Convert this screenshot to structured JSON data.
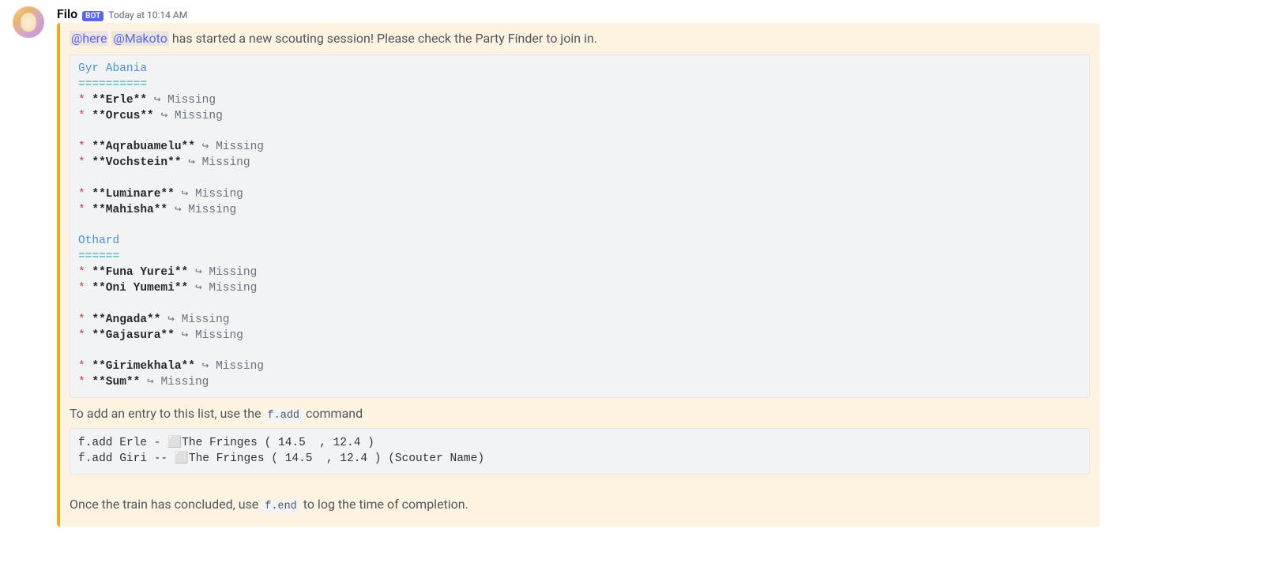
{
  "author": {
    "name": "Filo",
    "bot_label": "BOT",
    "timestamp": "Today at 10:14 AM"
  },
  "embed": {
    "mention_here": "@here",
    "mention_user": "@Makoto",
    "intro_rest": " has started a new scouting session! Please check the Party Finder to join in.",
    "regions": [
      {
        "name": "Gyr Abania",
        "underline": "==========",
        "groups": [
          [
            {
              "name": "Erle",
              "status": "Missing"
            },
            {
              "name": "Orcus",
              "status": "Missing"
            }
          ],
          [
            {
              "name": "Aqrabuamelu",
              "status": "Missing"
            },
            {
              "name": "Vochstein",
              "status": "Missing"
            }
          ],
          [
            {
              "name": "Luminare",
              "status": "Missing"
            },
            {
              "name": "Mahisha",
              "status": "Missing"
            }
          ]
        ]
      },
      {
        "name": "Othard",
        "underline": "======",
        "groups": [
          [
            {
              "name": "Funa Yurei",
              "status": "Missing"
            },
            {
              "name": "Oni Yumemi",
              "status": "Missing"
            }
          ],
          [
            {
              "name": "Angada",
              "status": "Missing"
            },
            {
              "name": "Gajasura",
              "status": "Missing"
            }
          ],
          [
            {
              "name": "Girimekhala",
              "status": "Missing"
            },
            {
              "name": "Sum",
              "status": "Missing"
            }
          ]
        ]
      }
    ],
    "help_add_pre": "To add an entry to this list, use the ",
    "help_add_cmd": "f.add",
    "help_add_post": " command",
    "example_block": "f.add Erle - ⬜The Fringes ( 14.5  , 12.4 )\nf.add Giri -- ⬜The Fringes ( 14.5  , 12.4 ) (Scouter Name)",
    "help_end_pre": "Once the train has concluded, use ",
    "help_end_cmd": "f.end",
    "help_end_post": " to log the time of completion."
  }
}
